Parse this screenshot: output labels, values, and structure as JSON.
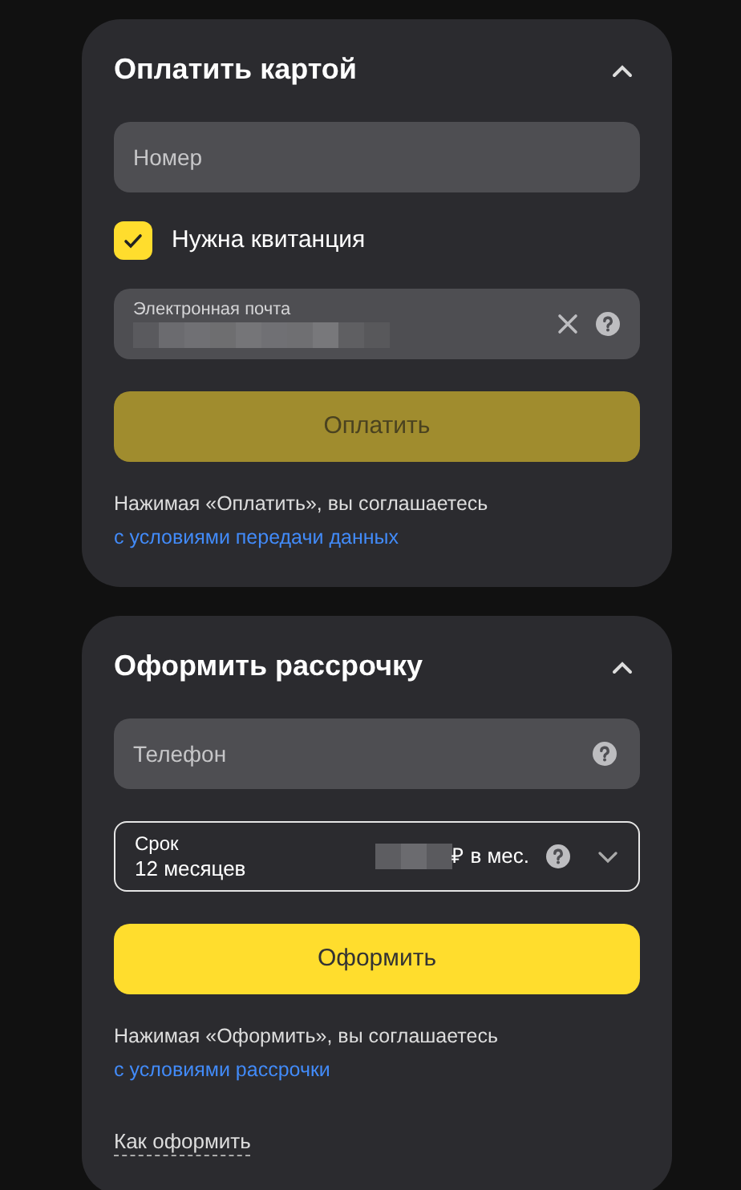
{
  "sections": [
    {
      "title": "Оплатить картой",
      "expanded": true,
      "items": [
        {
          "kind": "input",
          "placeholder": "Номер",
          "help": false
        },
        {
          "kind": "checkbox",
          "label": "Нужна квитанция",
          "checked": true
        },
        {
          "kind": "filled",
          "label": "Электронная почта",
          "clearable": true,
          "help": true
        },
        {
          "kind": "button",
          "label": "Оплатить",
          "disabled": true
        },
        {
          "kind": "consent",
          "text": "Нажимая «Оплатить», вы соглашаетесь",
          "link": "с условиями передачи данных"
        }
      ]
    },
    {
      "title": "Оформить рассрочку",
      "expanded": true,
      "items": [
        {
          "kind": "input",
          "placeholder": "Телефон",
          "help": true
        },
        {
          "kind": "select",
          "label": "Срок",
          "value": "12 месяцев",
          "suffix": "₽ в мес.",
          "help": true
        },
        {
          "kind": "button",
          "label": "Оформить",
          "disabled": false
        },
        {
          "kind": "consent",
          "text": "Нажимая «Оформить», вы соглашаетесь",
          "link": "с условиями рассрочки"
        },
        {
          "kind": "link",
          "label": "Как оформить"
        }
      ]
    }
  ]
}
